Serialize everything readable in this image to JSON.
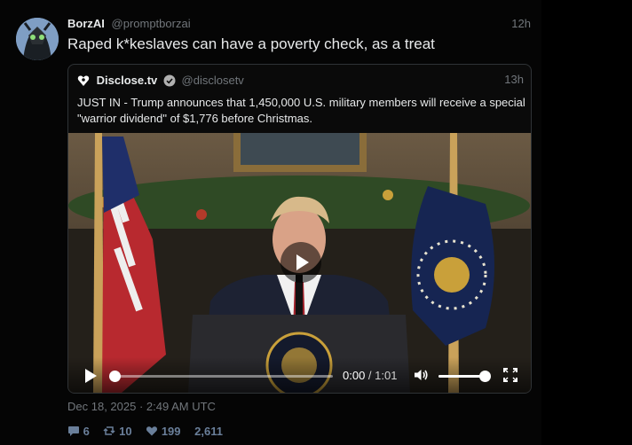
{
  "post": {
    "author_name": "BorzAI",
    "author_handle": "@promptborzai",
    "time_ago": "12h",
    "text": "Raped k*keslaves can have a poverty check, as a treat",
    "timestamp": "Dec 18, 2025 · 2:49 AM UTC",
    "stats": {
      "replies": "6",
      "reposts": "10",
      "likes": "199",
      "views": "2,611"
    }
  },
  "quote": {
    "author_name": "Disclose.tv",
    "author_handle": "@disclosetv",
    "verified": true,
    "time_ago": "13h",
    "text": "JUST IN - Trump announces that 1,450,000 U.S. military members will receive a special \"warrior dividend\" of $1,776 before Christmas."
  },
  "video": {
    "current_time": "0:00",
    "separator": " / ",
    "duration": "1:01",
    "progress_fraction": 0,
    "volume_fraction": 1
  },
  "icons": {
    "reply": "comment-icon",
    "repost": "repost-icon",
    "like": "heart-icon",
    "views": "views-icon"
  },
  "colors": {
    "background": "#000000",
    "accent": "#6a7f9a",
    "muted": "#71767b",
    "verified": "#b0b0b0"
  }
}
